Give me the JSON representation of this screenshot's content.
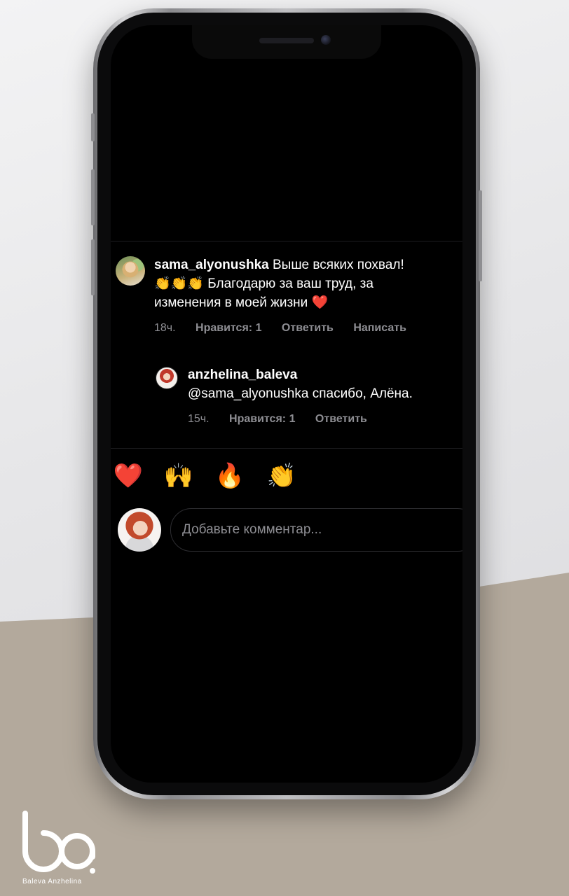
{
  "comments": [
    {
      "username": "sama_alyonushka",
      "line1": "Выше всяких похвал!",
      "line2_emojis": "👏👏👏",
      "line2_text": "Благодарю за ваш труд, за",
      "line3_text": "изменения в моей жизни",
      "line3_emoji": "❤️",
      "time": "18ч.",
      "likes": "Нравится: 1",
      "reply": "Ответить",
      "write": "Написать"
    },
    {
      "username": "anzhelina_baleva",
      "text": "@sama_alyonushka спасибо, Алёна.",
      "time": "15ч.",
      "likes": "Нравится: 1",
      "reply": "Ответить"
    }
  ],
  "reactions": [
    "❤️",
    "🙌",
    "🔥",
    "👏",
    "😢",
    "😍",
    "😮"
  ],
  "input": {
    "placeholder": "Добавьте комментар..."
  },
  "brand": {
    "caption": "Baleva Anzhelina"
  }
}
